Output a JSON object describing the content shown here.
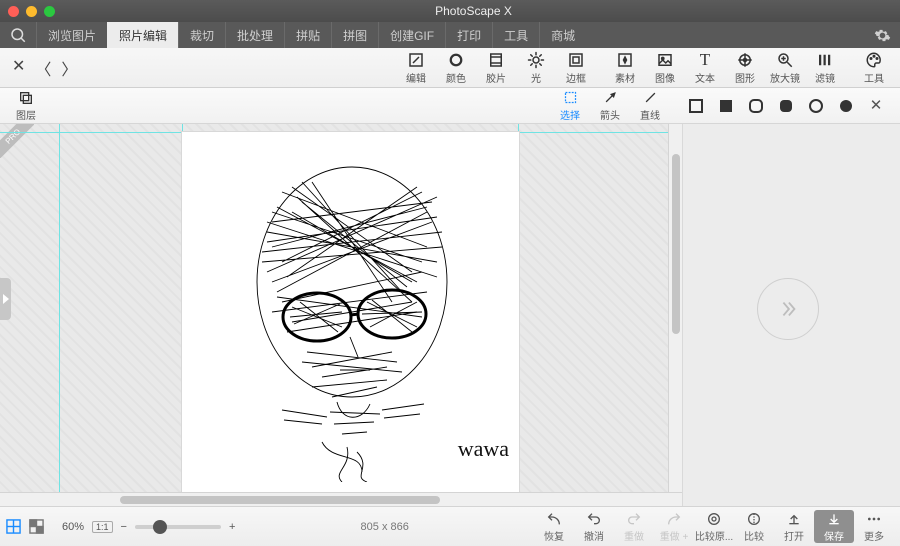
{
  "window": {
    "title": "PhotoScape X"
  },
  "maintabs": {
    "items": [
      {
        "label": "浏览图片"
      },
      {
        "label": "照片编辑"
      },
      {
        "label": "裁切"
      },
      {
        "label": "批处理"
      },
      {
        "label": "拼贴"
      },
      {
        "label": "拼图"
      },
      {
        "label": "创建GIF"
      },
      {
        "label": "打印"
      },
      {
        "label": "工具"
      },
      {
        "label": "商城"
      }
    ],
    "active_index": 1
  },
  "toolbar_left": {
    "edit": {
      "label": "编辑"
    },
    "color": {
      "label": "颜色"
    },
    "film": {
      "label": "胶片"
    },
    "light": {
      "label": "光"
    },
    "frame": {
      "label": "边框"
    }
  },
  "toolbar_right": {
    "sticker": {
      "label": "素材"
    },
    "image": {
      "label": "图像"
    },
    "text": {
      "label": "文本"
    },
    "shape": {
      "label": "图形"
    },
    "magnify": {
      "label": "放大镜"
    },
    "filter": {
      "label": "滤镜"
    },
    "tools": {
      "label": "工具"
    }
  },
  "subtoolbar": {
    "layers": {
      "label": "图层"
    },
    "select": {
      "label": "选择"
    },
    "arrow": {
      "label": "箭头"
    },
    "line": {
      "label": "直线"
    }
  },
  "canvas": {
    "signature": "wawa",
    "dimensions": "805 x 866",
    "pro_badge": "PRO"
  },
  "bottom": {
    "zoom_pct": "60%",
    "zoom_fit": "1:1",
    "undo": {
      "label": "恢复"
    },
    "redo": {
      "label": "撤消"
    },
    "redo2": {
      "label": "重做"
    },
    "reapply": {
      "label": "重做 +"
    },
    "compare_orig": {
      "label": "比较原..."
    },
    "compare": {
      "label": "比较"
    },
    "open": {
      "label": "打开"
    },
    "save": {
      "label": "保存"
    },
    "more": {
      "label": "更多"
    }
  }
}
